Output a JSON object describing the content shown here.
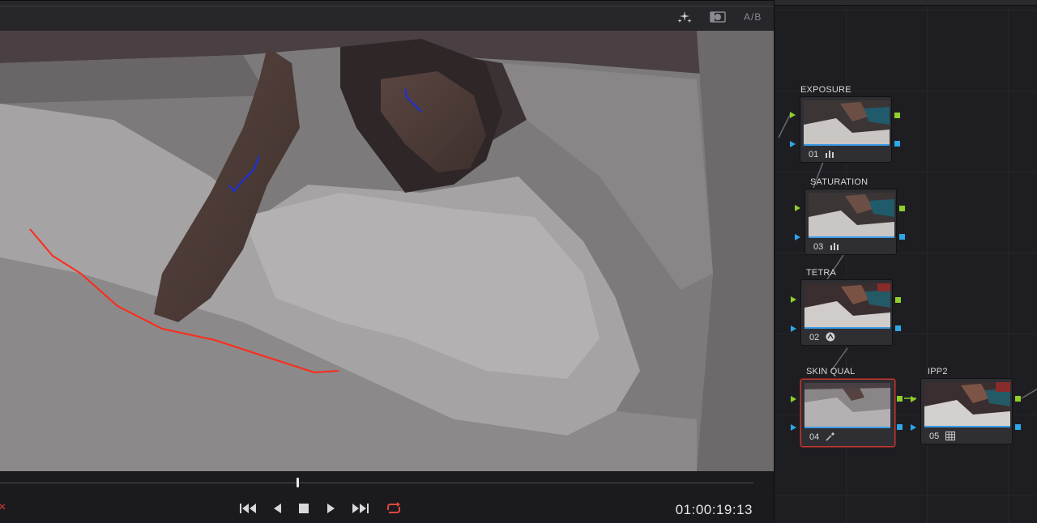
{
  "viewer": {
    "ab_label": "A/B",
    "timecode": "01:00:19:13",
    "close_glyph": "×",
    "topbar_icons": [
      "sparkle-icon",
      "highlight-mode-icon"
    ],
    "transport_icons": [
      "go-to-first-frame-icon",
      "play-reverse-icon",
      "stop-icon",
      "play-icon",
      "go-to-last-frame-icon",
      "loop-icon"
    ]
  },
  "node_graph": {
    "nodes": [
      {
        "label": "EXPOSURE",
        "number": "01",
        "tool": "bars-icon",
        "selected": false
      },
      {
        "label": "SATURATION",
        "number": "03",
        "tool": "bars-icon",
        "selected": false
      },
      {
        "label": "TETRA",
        "number": "02",
        "tool": "circle-icon",
        "selected": false
      },
      {
        "label": "SKIN QUAL",
        "number": "04",
        "tool": "eyedropper-icon",
        "selected": true
      },
      {
        "label": "IPP2",
        "number": "05",
        "tool": "grid-icon",
        "selected": false
      }
    ]
  },
  "colors": {
    "accent_green": "#8fcf2a",
    "accent_blue": "#2ea7e8",
    "selected_border": "#c23b32",
    "loop_active": "#e0463c",
    "annotation_red": "#ff2a1a",
    "annotation_blue": "#1a2fe0"
  }
}
